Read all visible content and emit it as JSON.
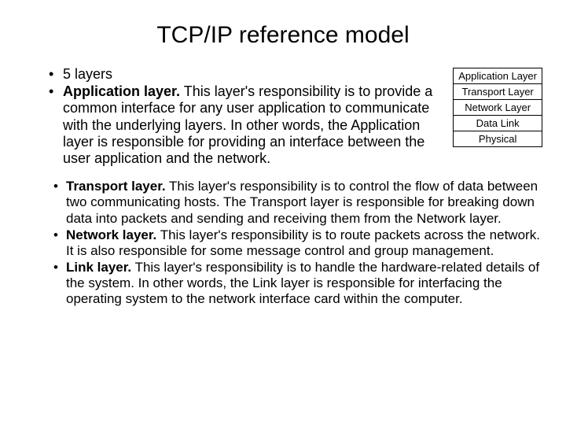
{
  "title": "TCP/IP reference model",
  "top_bullets": {
    "b0_text": "5 layers",
    "b1_bold": "Application layer.",
    "b1_text": " This layer's responsibility is to provide a common interface for any user application to communicate with the underlying layers. In other words, the Application layer is responsible for providing an interface between the user application and the network."
  },
  "layers": {
    "r0": "Application Layer",
    "r1": "Transport Layer",
    "r2": "Network Layer",
    "r3": "Data Link",
    "r4": "Physical"
  },
  "bottom_bullets": {
    "b0_bold": "Transport layer.",
    "b0_text": " This layer's responsibility is to control the flow of data between two communicating hosts. The Transport layer is responsible for breaking down data into packets and sending and receiving them from the Network layer.",
    "b1_bold": "Network layer.",
    "b1_text": " This layer's responsibility is to route packets across the network. It is also responsible for some message control and group management.",
    "b2_bold": "Link layer.",
    "b2_text": " This layer's responsibility is to handle the hardware-related details of the system. In other words, the Link layer is responsible for interfacing the operating system to the network interface card within the computer."
  }
}
